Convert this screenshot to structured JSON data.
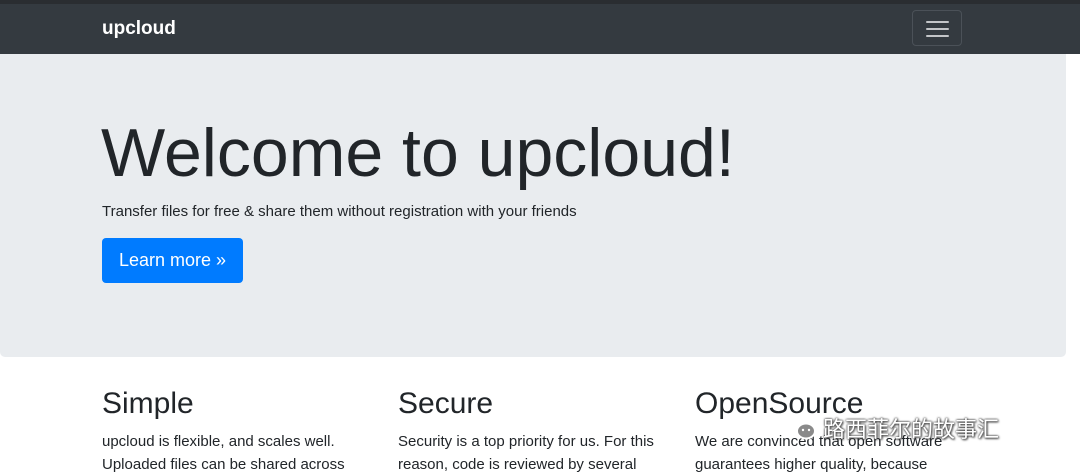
{
  "navbar": {
    "brand": "upcloud",
    "toggler_icon": "hamburger-menu-icon"
  },
  "jumbotron": {
    "title": "Welcome to upcloud!",
    "lead": "Transfer files for free & share them without registration with your friends",
    "button_label": "Learn more »"
  },
  "features": [
    {
      "title": "Simple",
      "text": "upcloud is flexible, and scales well. Uploaded files can be shared across"
    },
    {
      "title": "Secure",
      "text": "Security is a top priority for us. For this reason, code is reviewed by several"
    },
    {
      "title": "OpenSource",
      "text": "We are convinced that open software guarantees higher quality, because"
    }
  ],
  "watermark": {
    "text": "路西菲尔的故事汇",
    "icon": "wechat-icon"
  },
  "colors": {
    "navbar_bg": "#343a40",
    "jumbotron_bg": "#e9ecef",
    "primary_button": "#007bff"
  }
}
